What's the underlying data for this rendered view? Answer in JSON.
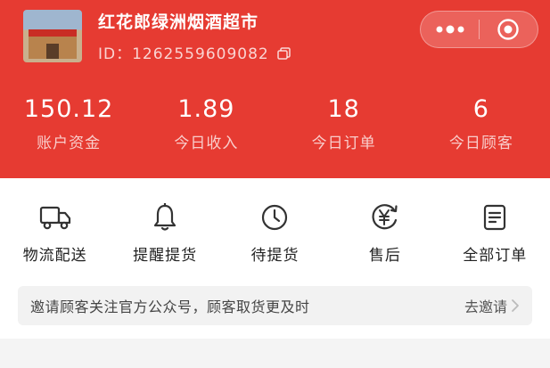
{
  "colors": {
    "brand": "#e63b32",
    "panel": "#ffffff",
    "background": "#f4f4f4"
  },
  "store": {
    "name": "红花郎绿洲烟酒超市",
    "id_text": "ID：1262559609082",
    "photo_icon": "store-photo"
  },
  "capsule": {
    "more_icon": "more-dots-icon",
    "close_icon": "target-circle-icon"
  },
  "stats": [
    {
      "value": "150.12",
      "label": "账户资金"
    },
    {
      "value": "1.89",
      "label": "今日收入"
    },
    {
      "value": "18",
      "label": "今日订单"
    },
    {
      "value": "6",
      "label": "今日顾客"
    }
  ],
  "actions": [
    {
      "label": "物流配送",
      "icon": "truck-icon"
    },
    {
      "label": "提醒提货",
      "icon": "bell-icon"
    },
    {
      "label": "待提货",
      "icon": "clock-icon"
    },
    {
      "label": "售后",
      "icon": "yen-refund-icon"
    },
    {
      "label": "全部订单",
      "icon": "order-list-icon"
    }
  ],
  "invite": {
    "text": "邀请顾客关注官方公众号，顾客取货更及时",
    "link": "去邀请"
  }
}
